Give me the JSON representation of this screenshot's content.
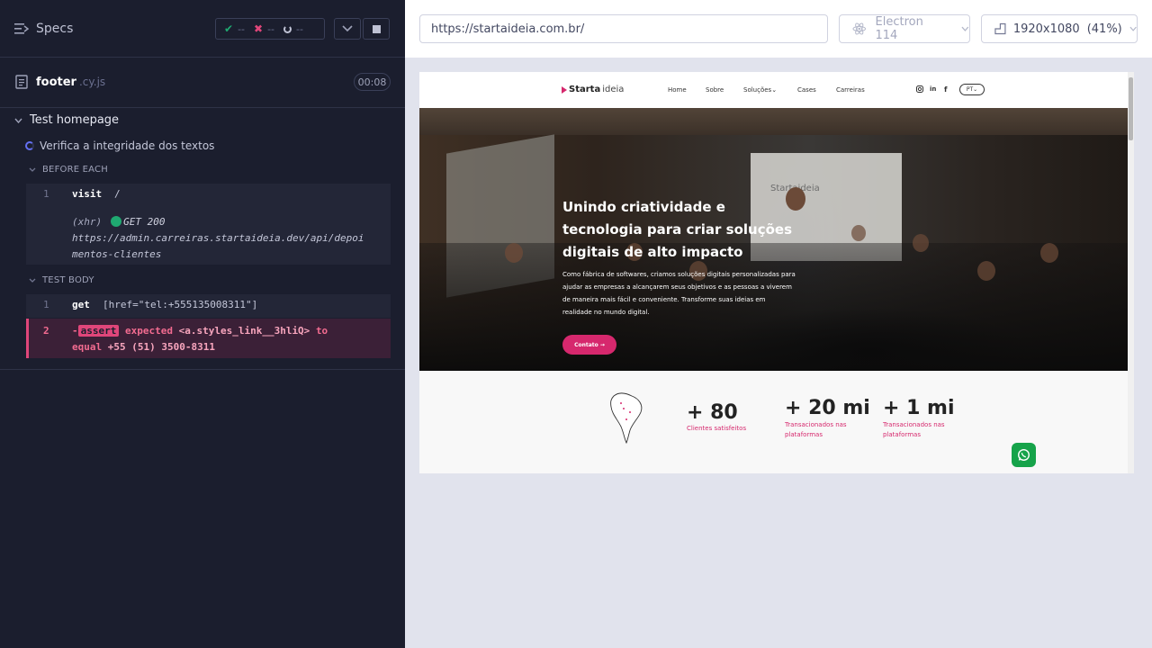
{
  "reporter": {
    "specs_label": "Specs",
    "stats": {
      "passed": "--",
      "failed": "--",
      "pending": "--"
    },
    "file": {
      "name": "footer",
      "ext": ".cy.js",
      "duration": "00:08"
    },
    "suite_title": "Test homepage",
    "test_title": "Verifica a integridade dos textos",
    "before_each": {
      "label": "BEFORE EACH",
      "commands": [
        {
          "num": "1",
          "name": "visit",
          "message": "/"
        }
      ],
      "xhr": {
        "type": "(xhr)",
        "method": "GET 200",
        "url": "https://admin.carreiras.startaideia.dev/api/depoi",
        "url2": "mentos-clientes"
      }
    },
    "test_body": {
      "label": "TEST BODY",
      "commands": [
        {
          "num": "1",
          "name": "get",
          "message": "[href=\"tel:+555135008311\"]"
        }
      ],
      "error": {
        "num": "2",
        "prefix": "-",
        "tag": "assert",
        "expected": "expected",
        "subject": "<a.styles_link__3hliQ>",
        "to": "to",
        "equal": "equal",
        "value": "+55 (51) 3500-8311"
      }
    }
  },
  "toolbar": {
    "url": "https://startaideia.com.br/",
    "browser": "Electron 114",
    "viewport": "1920x1080",
    "zoom": "(41%)"
  },
  "site": {
    "logo_bold": "Starta",
    "logo_light": "ideia",
    "nav": [
      "Home",
      "Sobre",
      "Soluções",
      "Cases",
      "Carreiras"
    ],
    "lang": "PT",
    "hero_screen_text": "Startaideia",
    "hero_title": "Unindo criatividade e tecnologia para criar soluções digitais de alto impacto",
    "hero_sub": "Como fábrica de softwares, criamos soluções digitais personalizadas para ajudar as empresas a alcançarem seus objetivos e as pessoas a viverem de maneira mais fácil e conveniente. Transforme suas ideias em realidade no mundo digital.",
    "cta": "Contato →",
    "stats": [
      {
        "value": "+ 80",
        "label": "Clientes satisfeitos"
      },
      {
        "value": "+ 20 mi",
        "label": "Transacionados nas plataformas"
      },
      {
        "value": "+ 1 mi",
        "label": "Transacionados nas plataformas"
      }
    ],
    "brand_color": "#d6286d"
  },
  "colors": {
    "reporter_bg": "#1b1e2e",
    "error_bg": "#3b2037",
    "error_accent": "#e0467a",
    "pass_green": "#1fa971",
    "running_blue": "#6470f3"
  }
}
